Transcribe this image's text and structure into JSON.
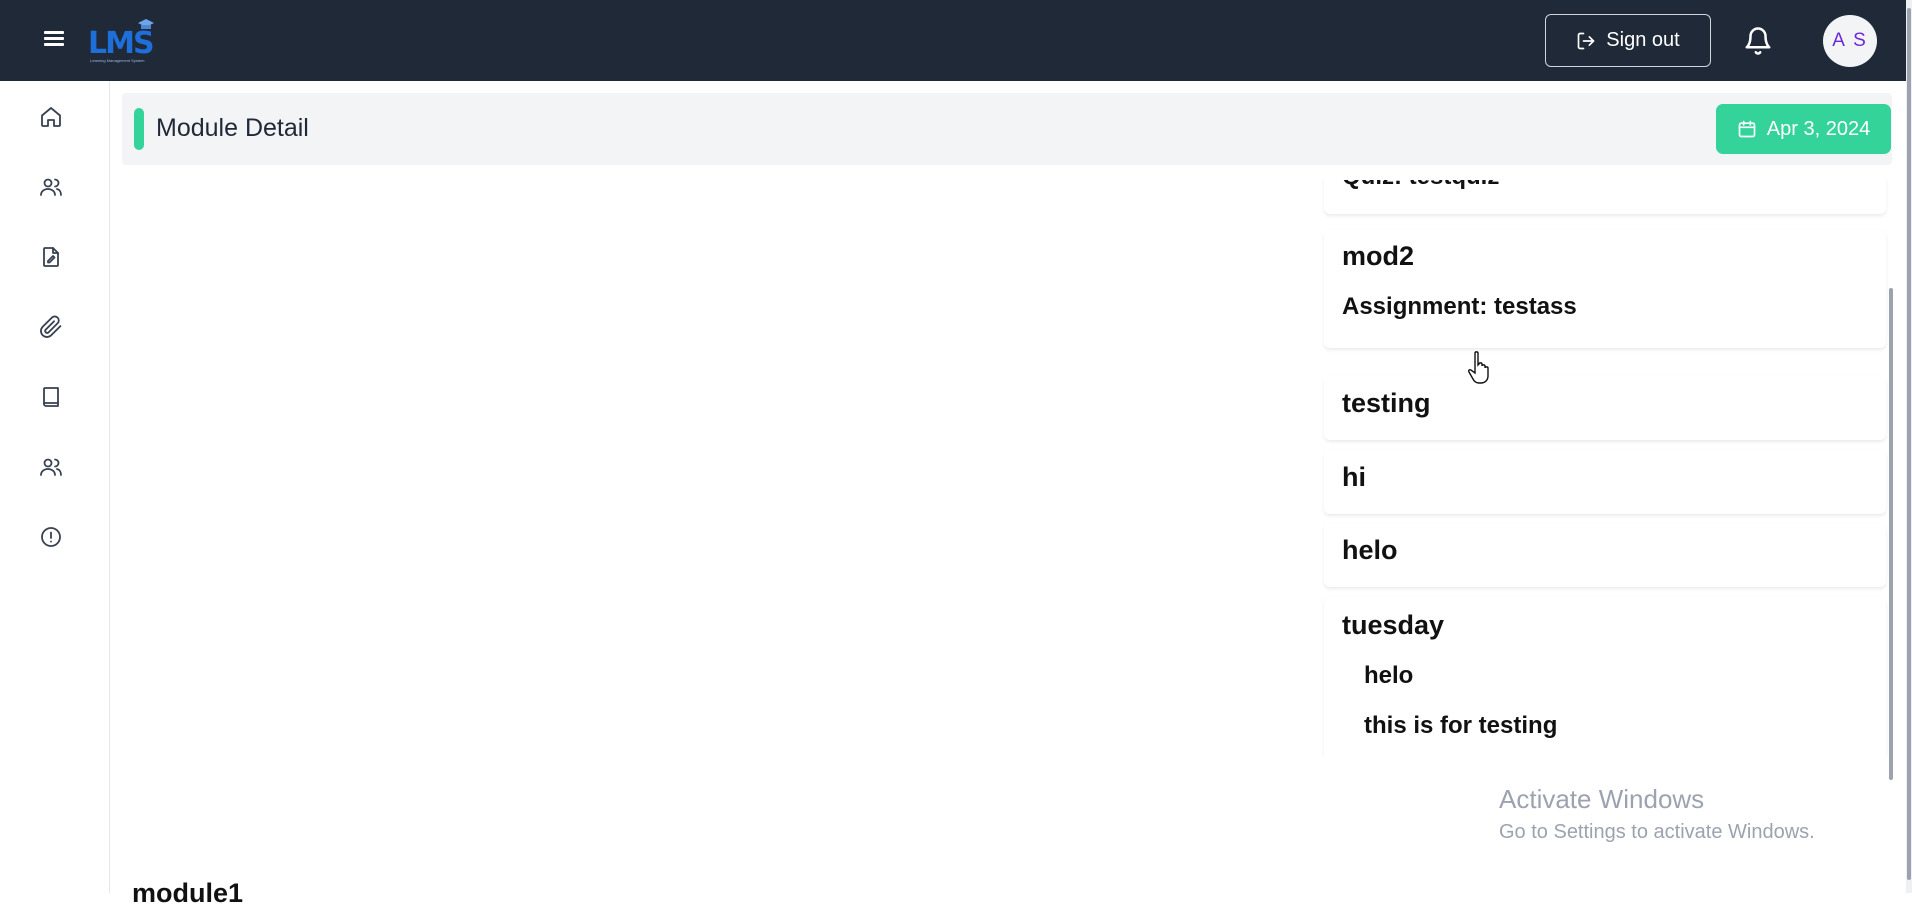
{
  "header": {
    "logo_text": "LMS",
    "logo_subtext": "Learning Management System",
    "sign_out_label": "Sign out",
    "avatar_initials": "A S"
  },
  "sidebar": {
    "items": [
      {
        "icon": "home-icon"
      },
      {
        "icon": "users-icon"
      },
      {
        "icon": "document-edit-icon"
      },
      {
        "icon": "paperclip-icon"
      },
      {
        "icon": "book-icon"
      },
      {
        "icon": "users-group-icon"
      },
      {
        "icon": "info-circle-icon"
      }
    ]
  },
  "page": {
    "title": "Module Detail",
    "date": "Apr 3, 2024"
  },
  "modules": [
    {
      "title": "",
      "items": [
        "Quiz: testquiz"
      ]
    },
    {
      "title": "mod2",
      "items": [
        "Assignment: testass"
      ]
    },
    {
      "title": "testing",
      "items": []
    },
    {
      "title": "hi",
      "items": []
    },
    {
      "title": "helo",
      "items": []
    },
    {
      "title": "tuesday",
      "items": [
        "helo",
        "this is for testing"
      ]
    }
  ],
  "bottom_module_title": "module1",
  "watermark": {
    "line1": "Activate Windows",
    "line2": "Go to Settings to activate Windows."
  },
  "colors": {
    "topbar": "#1f2937",
    "accent": "#34d399",
    "avatar_text": "#6d28d9"
  }
}
